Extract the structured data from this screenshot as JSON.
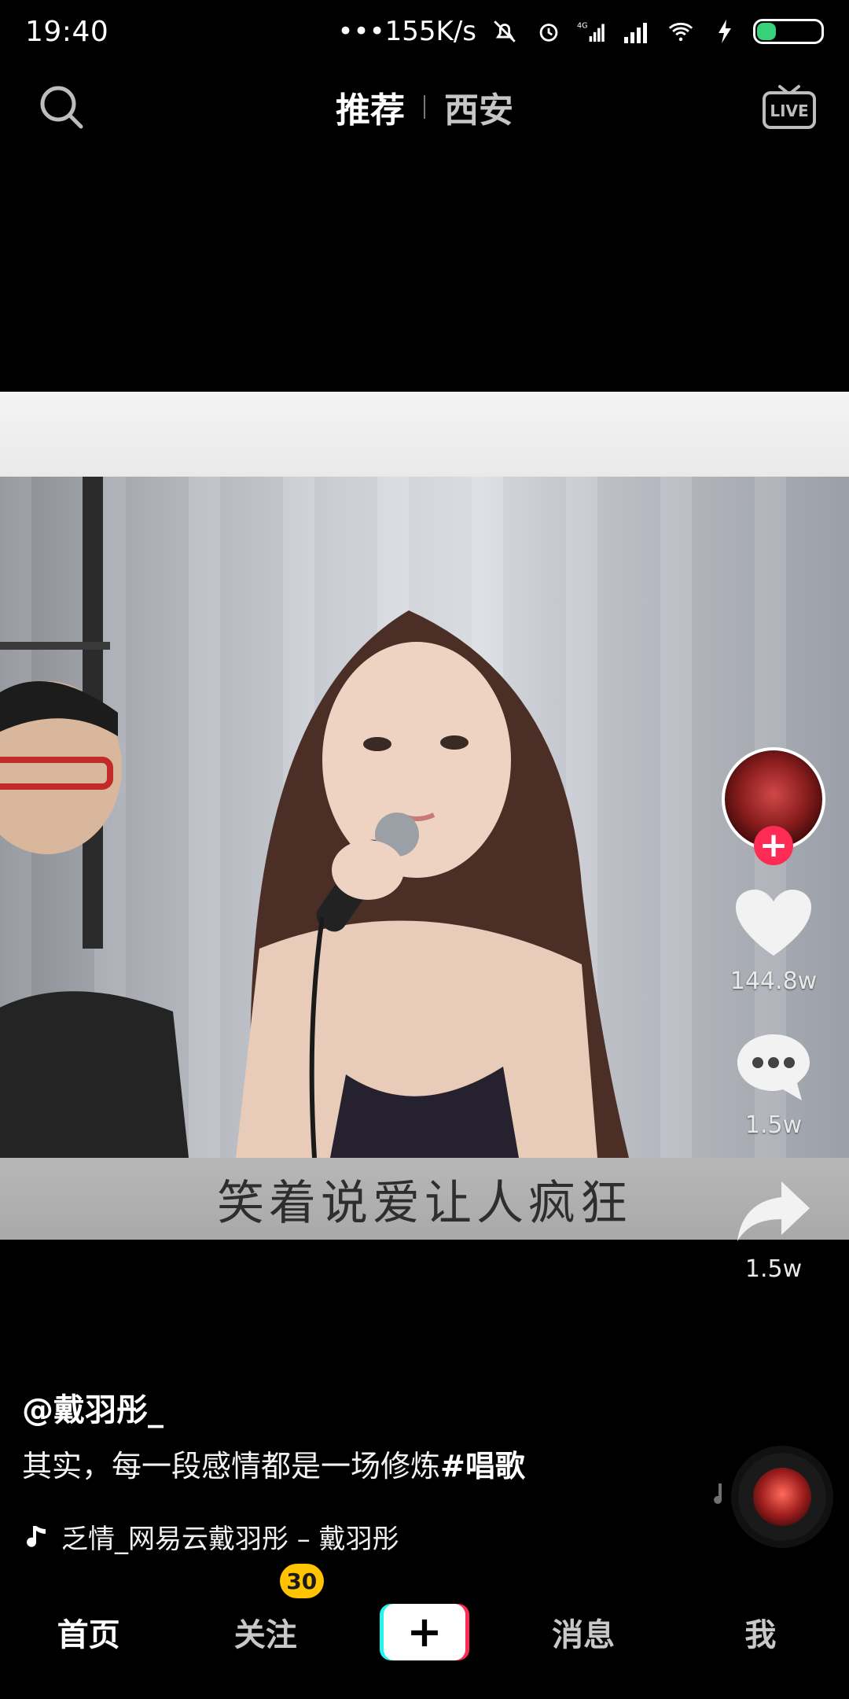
{
  "status_bar": {
    "time": "19:40",
    "speed": "•••155K/s",
    "network": "4G",
    "battery": "27"
  },
  "header": {
    "tabs": [
      {
        "label": "推荐"
      },
      {
        "label": "西安"
      }
    ],
    "live_label": "LIVE"
  },
  "video": {
    "caption": "笑着说爱让人疯狂"
  },
  "actions": {
    "likes": "144.8w",
    "comments": "1.5w",
    "shares": "1.5w"
  },
  "post": {
    "author": "@戴羽彤_",
    "description": "其实，每一段感情都是一场修炼",
    "hashtag": "#唱歌",
    "music": "乏情_网易云戴羽彤 – 戴羽彤"
  },
  "nav": {
    "home": "首页",
    "following": "关注",
    "following_badge": "30",
    "create": "+",
    "messages": "消息",
    "me": "我"
  },
  "colors": {
    "accent_red": "#fe2c55",
    "accent_cyan": "#25f4ee",
    "badge_yellow": "#ffc300"
  }
}
